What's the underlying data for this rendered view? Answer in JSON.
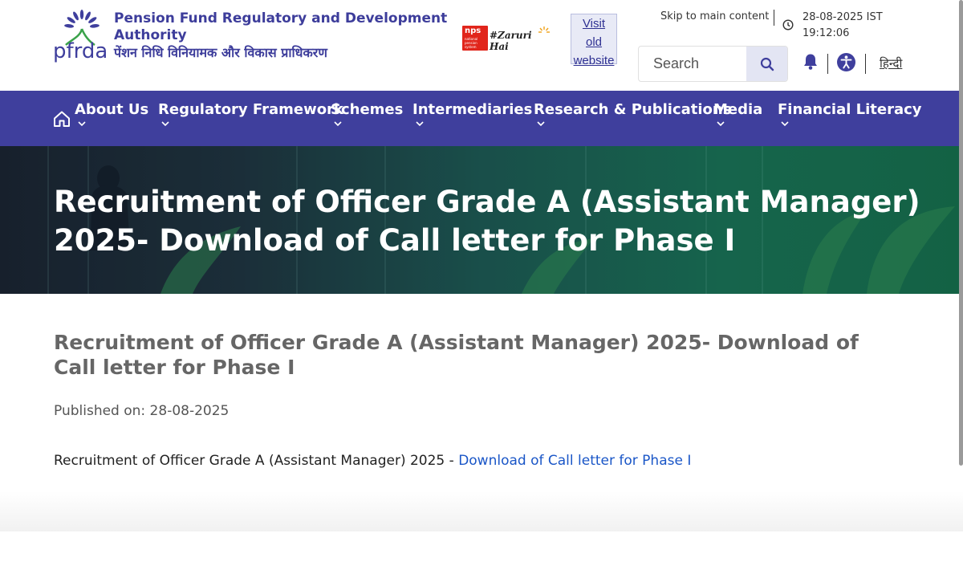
{
  "header": {
    "org_name_en": "Pension Fund Regulatory and Development Authority",
    "org_name_hi": "पेंशन निधि विनियामक और विकास प्राधिकरण",
    "logo_text": "pfrda",
    "nps_logo_text": "nps",
    "nps_logo_subtext": "national pension system",
    "nps_tagline": "#Zaruri Hai",
    "old_website": [
      "Visit",
      "old",
      "website"
    ],
    "skip_link": "Skip to main content",
    "date": "28-08-2025 IST",
    "time": "19:12:06",
    "search_placeholder": "Search",
    "hindi_link": "हिन्दी"
  },
  "nav": {
    "items": [
      {
        "label": "About Us"
      },
      {
        "label": "Regulatory Framework"
      },
      {
        "label": "Schemes"
      },
      {
        "label": "Intermediaries"
      },
      {
        "label": "Research & Publications"
      },
      {
        "label": "Media"
      },
      {
        "label": "Financial Literacy"
      }
    ]
  },
  "banner": {
    "title": "Recruitment of Officer Grade A (Assistant Manager) 2025- Download of Call letter for Phase I"
  },
  "main": {
    "title": "Recruitment of Officer Grade A (Assistant Manager) 2025- Download of Call letter for Phase I",
    "published": "Published on: 28-08-2025",
    "content_prefix": "Recruitment of Officer Grade A (Assistant Manager) 2025 - ",
    "content_link": "Download of Call letter for Phase I"
  },
  "colors": {
    "brand_purple": "#3f3f9d",
    "logo_green": "#3aa24a",
    "link_blue": "#1a56c7",
    "nps_red": "#e1251b"
  },
  "icons": [
    "home-icon",
    "chevron-down-icon",
    "search-icon",
    "clock-icon",
    "bell-icon",
    "accessibility-icon"
  ]
}
